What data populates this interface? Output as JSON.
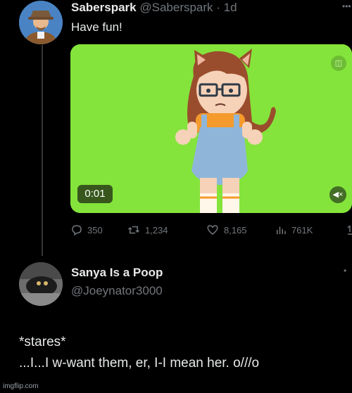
{
  "tweet1": {
    "name": "Saberspark",
    "handle": "@Saberspark",
    "time": "· 1d",
    "text": "Have fun!",
    "media": {
      "timer": "0:01",
      "background_color": "#84e43b"
    },
    "actions": {
      "replies": "350",
      "retweets": "1,234",
      "likes": "8,165",
      "views": "761K"
    }
  },
  "tweet2": {
    "name": "Sanya Is a Poop",
    "handle": "@Joeynator3000",
    "lines": [
      "*stares*",
      "...I...I w-want them, er, I-I mean her. o///o"
    ]
  },
  "watermark": "imgflip.com"
}
